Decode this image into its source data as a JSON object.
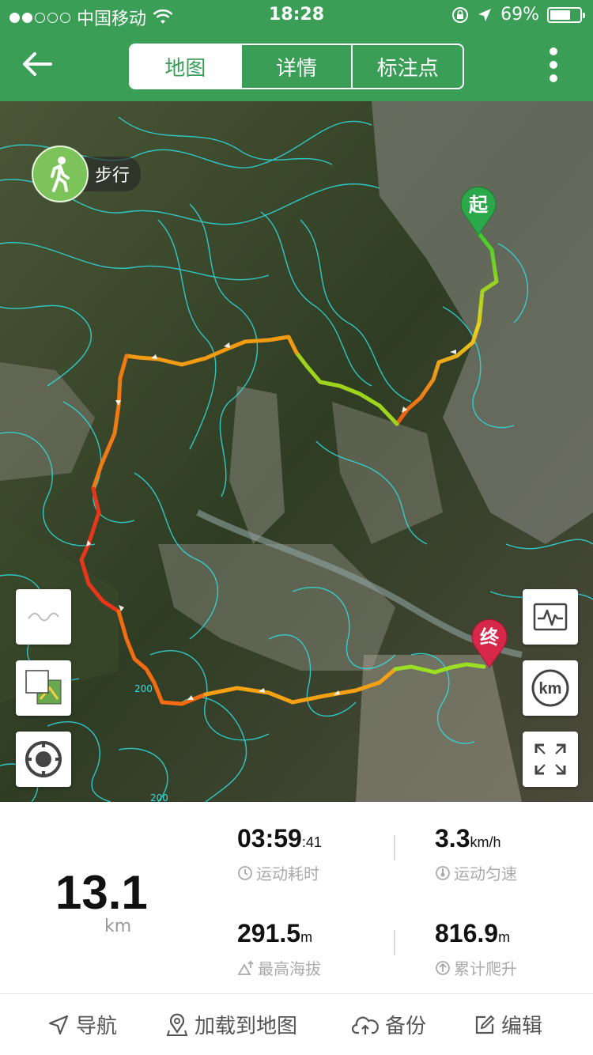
{
  "status_bar": {
    "carrier": "中国移动",
    "time": "18:28",
    "battery": "69%",
    "battery_level": 0.69
  },
  "header": {
    "tabs": [
      {
        "label": "地图",
        "active": true
      },
      {
        "label": "详情",
        "active": false
      },
      {
        "label": "标注点",
        "active": false
      }
    ]
  },
  "map": {
    "mode_label": "步行",
    "start_marker": "起",
    "end_marker": "终",
    "contour_labels": [
      "200",
      "200"
    ]
  },
  "stats": {
    "distance": "13.1",
    "distance_unit": "km",
    "duration_main": "03:59",
    "duration_sec": ":41",
    "duration_label": "运动耗时",
    "speed_value": "3.3",
    "speed_unit": "km/h",
    "speed_label": "运动匀速",
    "max_alt_value": "291.5",
    "max_alt_unit": "m",
    "max_alt_label": "最高海拔",
    "climb_value": "816.9",
    "climb_unit": "m",
    "climb_label": "累计爬升"
  },
  "bottom_bar": {
    "navigate": "导航",
    "load_to_map": "加载到地图",
    "backup": "备份",
    "edit": "编辑"
  },
  "colors": {
    "brand_green": "#3a9e57",
    "contour": "#2ee0e0",
    "start_marker": "#2aa84a",
    "end_marker": "#d8284a"
  }
}
